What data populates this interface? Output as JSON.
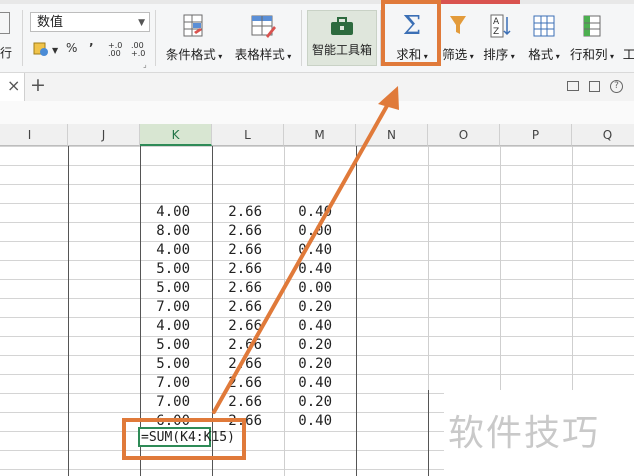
{
  "ribbon": {
    "left_partial_label": "行",
    "number_format": {
      "value": "数值"
    },
    "percent_symbol": "%",
    "comma_symbol": "’",
    "decimal_increase": "+.0\n.00",
    "decimal_decrease": ".00\n+.0",
    "buttons": {
      "conditional_format": "条件格式",
      "table_style": "表格样式",
      "smart_toolbox": "智能工具箱",
      "sum": "求和",
      "filter": "筛选",
      "sort": "排序",
      "format": "格式",
      "row_col": "行和列",
      "work_partial": "工"
    }
  },
  "tabbar": {
    "close_symbol": "×",
    "add_symbol": "+"
  },
  "columns": [
    "I",
    "J",
    "K",
    "L",
    "M",
    "N",
    "O",
    "P",
    "Q"
  ],
  "active_column": "K",
  "rows": [
    {
      "k": "4.00",
      "l": "2.66",
      "m": "0.40"
    },
    {
      "k": "8.00",
      "l": "2.66",
      "m": "0.00"
    },
    {
      "k": "4.00",
      "l": "2.66",
      "m": "0.40"
    },
    {
      "k": "5.00",
      "l": "2.66",
      "m": "0.40"
    },
    {
      "k": "5.00",
      "l": "2.66",
      "m": "0.00"
    },
    {
      "k": "7.00",
      "l": "2.66",
      "m": "0.20"
    },
    {
      "k": "4.00",
      "l": "2.66",
      "m": "0.40"
    },
    {
      "k": "5.00",
      "l": "2.66",
      "m": "0.20"
    },
    {
      "k": "5.00",
      "l": "2.66",
      "m": "0.20"
    },
    {
      "k": "7.00",
      "l": "2.66",
      "m": "0.40"
    },
    {
      "k": "7.00",
      "l": "2.66",
      "m": "0.20"
    },
    {
      "k": "6.00",
      "l": "2.66",
      "m": "0.40"
    }
  ],
  "formula_cell": "=SUM(K4:K15)",
  "watermark": "软件技巧",
  "colors": {
    "highlight": "#e07a3a",
    "active_cell": "#2e8b57"
  }
}
